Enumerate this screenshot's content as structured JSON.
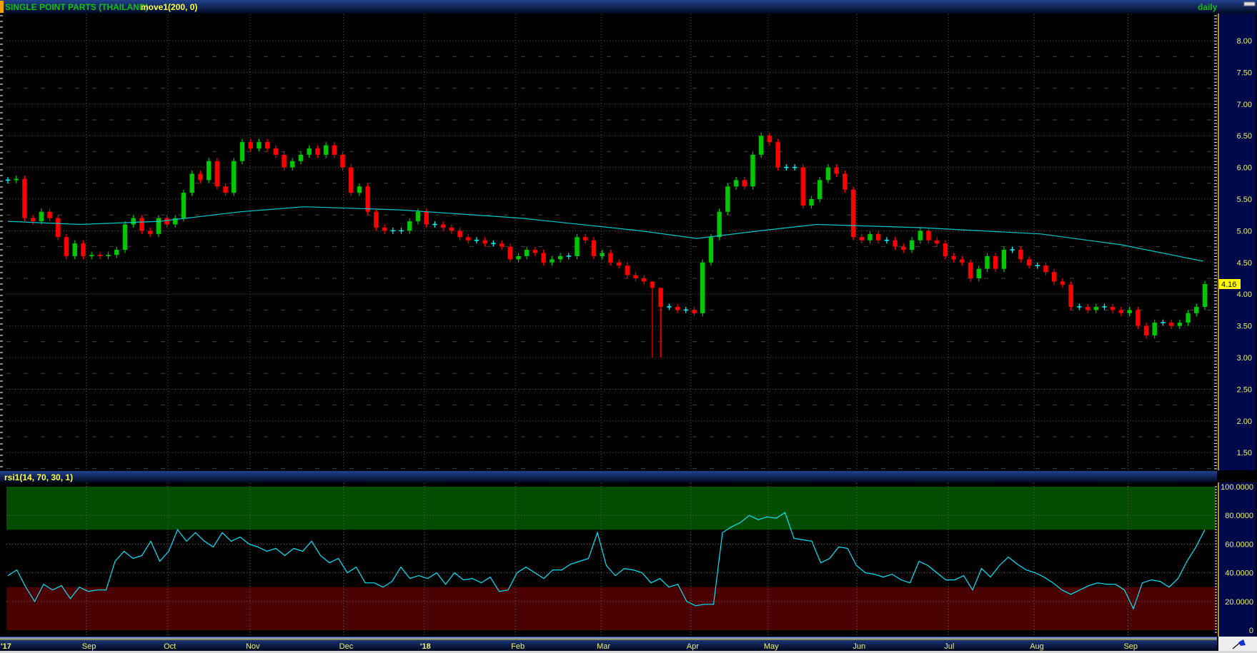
{
  "header": {
    "symbol": "SINGLE POINT PARTS (THAILAND)",
    "study": "move1(200, 0)",
    "interval": "daily"
  },
  "rsi_header": {
    "study": "rsi1(14, 70, 30, 1)"
  },
  "colors": {
    "up": "#00c800",
    "down": "#ff0000",
    "doji": "#00ffff",
    "ma": "#00c8c8",
    "rsi": "#00e8ff",
    "overbought": "#004d00",
    "oversold": "#4a0000",
    "axis_text": "#f0f070",
    "last_price_bg": "#ffff00"
  },
  "chart_data": [
    {
      "type": "candlestick",
      "title": "SINGLE POINT PARTS (THAILAND)",
      "x_unit": "trading day index",
      "x_range": [
        0,
        296
      ],
      "ylim": [
        1.25,
        8.4
      ],
      "yticks": [
        "8.00",
        "7.50",
        "7.00",
        "6.50",
        "6.00",
        "5.50",
        "5.00",
        "4.50",
        "4.00",
        "3.50",
        "3.00",
        "2.50",
        "2.00",
        "1.50"
      ],
      "last_price": "4.16",
      "closes": [
        5.8,
        5.82,
        5.2,
        5.15,
        5.3,
        5.2,
        4.9,
        4.6,
        4.8,
        4.6,
        4.62,
        4.6,
        4.62,
        4.7,
        5.1,
        5.2,
        5.0,
        4.95,
        5.2,
        5.1,
        5.2,
        5.6,
        5.9,
        5.8,
        6.1,
        5.7,
        5.6,
        6.1,
        6.4,
        6.3,
        6.4,
        6.3,
        6.2,
        6.0,
        6.1,
        6.2,
        6.3,
        6.2,
        6.35,
        6.2,
        6.0,
        5.6,
        5.7,
        5.3,
        5.05,
        5.0,
        5.0,
        5.0,
        5.15,
        5.3,
        5.1,
        5.1,
        5.05,
        5.0,
        4.9,
        4.85,
        4.85,
        4.8,
        4.8,
        4.75,
        4.55,
        4.6,
        4.7,
        4.65,
        4.5,
        4.55,
        4.6,
        4.6,
        4.9,
        4.85,
        4.6,
        4.65,
        4.5,
        4.45,
        4.3,
        4.25,
        4.2,
        [
          4.1,
          3.0,
          4.2
        ],
        [
          3.8,
          3.0,
          4.05
        ],
        3.8,
        3.75,
        3.75,
        3.7,
        4.5,
        4.9,
        5.3,
        5.7,
        5.8,
        5.7,
        6.2,
        6.5,
        6.4,
        6.0,
        6.0,
        6.0,
        5.4,
        5.5,
        5.8,
        6.0,
        5.9,
        5.65,
        4.9,
        4.85,
        4.95,
        4.85,
        4.85,
        4.75,
        4.7,
        4.85,
        5.0,
        4.85,
        4.8,
        4.6,
        4.55,
        4.5,
        4.25,
        4.4,
        4.6,
        4.4,
        4.7,
        4.7,
        4.55,
        4.45,
        4.45,
        4.35,
        4.2,
        4.15,
        3.8,
        3.8,
        3.75,
        3.8,
        3.8,
        3.75,
        3.7,
        3.75,
        3.5,
        3.35,
        3.55,
        3.55,
        3.5,
        3.55,
        3.7,
        3.8,
        4.16
      ],
      "ma_series": {
        "name": "move1(200, 0)",
        "points": [
          [
            0,
            5.15
          ],
          [
            17.8,
            5.1
          ],
          [
            37.6,
            5.15
          ],
          [
            57.4,
            5.3
          ],
          [
            73.3,
            5.38
          ],
          [
            97,
            5.33
          ],
          [
            126.7,
            5.2
          ],
          [
            156.4,
            5.0
          ],
          [
            170.3,
            4.88
          ],
          [
            186,
            5.0
          ],
          [
            200,
            5.1
          ],
          [
            225.7,
            5.05
          ],
          [
            255.4,
            4.95
          ],
          [
            275.2,
            4.78
          ],
          [
            295.6,
            4.52
          ]
        ]
      },
      "x_ticks": [
        {
          "label": "'17",
          "day": 0
        },
        {
          "label": "Sep",
          "day": 19.4
        },
        {
          "label": "Oct",
          "day": 39.6
        },
        {
          "label": "Nov",
          "day": 59.9
        },
        {
          "label": "Dec",
          "day": 83
        },
        {
          "label": "'18",
          "day": 103
        },
        {
          "label": "Feb",
          "day": 125.5
        },
        {
          "label": "Mar",
          "day": 146.7
        },
        {
          "label": "Apr",
          "day": 168.9
        },
        {
          "label": "May",
          "day": 188
        },
        {
          "label": "Jun",
          "day": 210
        },
        {
          "label": "Jul",
          "day": 232.6
        },
        {
          "label": "Aug",
          "day": 253.8
        },
        {
          "label": "Sep",
          "day": 277
        }
      ]
    },
    {
      "type": "line",
      "title": "rsi1(14, 70, 30, 1)",
      "ylim": [
        0,
        100
      ],
      "overbought": 70,
      "oversold": 30,
      "yticks": [
        "100.0000",
        "80.0000",
        "60.0000",
        "40.0000",
        "20.0000",
        "0"
      ],
      "values": [
        38,
        42,
        30,
        20,
        32,
        28,
        31,
        22,
        30,
        27,
        28,
        28,
        48,
        55,
        50,
        52,
        62,
        48,
        55,
        70,
        62,
        68,
        62,
        58,
        68,
        62,
        65,
        60,
        58,
        55,
        57,
        52,
        57,
        55,
        62,
        52,
        47,
        50,
        40,
        44,
        33,
        33,
        30,
        34,
        44,
        36,
        38,
        36,
        40,
        32,
        40,
        35,
        36,
        33,
        37,
        27,
        28,
        40,
        44,
        40,
        36,
        42,
        42,
        46,
        48,
        50,
        68,
        45,
        38,
        43,
        42,
        40,
        33,
        36,
        30,
        32,
        20,
        17,
        18,
        18,
        68,
        72,
        75,
        80,
        77,
        79,
        78,
        82,
        64,
        63,
        62,
        47,
        50,
        58,
        57,
        45,
        40,
        39,
        37,
        39,
        35,
        33,
        48,
        45,
        40,
        35,
        35,
        38,
        28,
        43,
        37,
        45,
        51,
        46,
        42,
        40,
        37,
        33,
        28,
        25,
        28,
        31,
        33,
        32,
        32,
        28,
        15,
        33,
        35,
        34,
        30,
        36,
        48,
        58,
        70
      ]
    }
  ]
}
